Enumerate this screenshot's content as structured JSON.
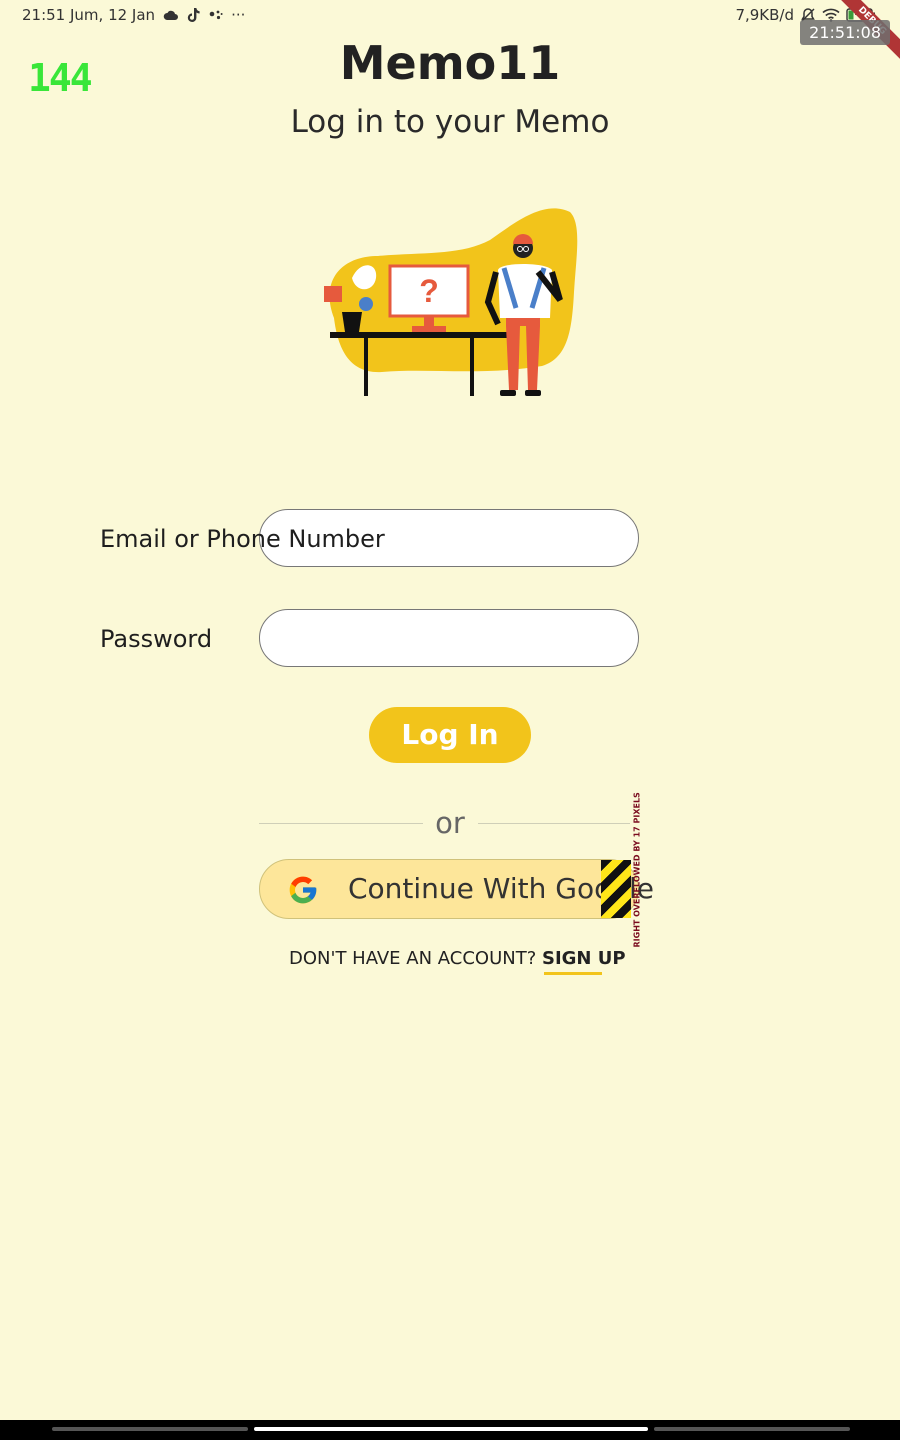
{
  "status_bar": {
    "time_date": "21:51 Jum, 12 Jan",
    "more": "···",
    "network_speed": "7,9KB/d",
    "battery_level": "14"
  },
  "overlays": {
    "fps_counter": "144",
    "clock": "21:51:08",
    "debug_banner": "DEBUG"
  },
  "header": {
    "title": "Memo11",
    "subtitle": "Log in to your Memo"
  },
  "illustration": {
    "monitor_symbol": "?"
  },
  "form": {
    "email_label": "Email or Phone Number",
    "email_value": "",
    "password_label": "Password",
    "password_value": "",
    "login_label": "Log In"
  },
  "divider": {
    "text": "or"
  },
  "google": {
    "label": "Continue With Google",
    "overflow_warning": "RIGHT OVERFLOWED BY 17 PIXELS"
  },
  "signup": {
    "prompt": "DON'T HAVE AN ACCOUNT?",
    "link": "SIGN UP"
  },
  "colors": {
    "background": "#fbf9d7",
    "accent": "#f2c41b",
    "google_button": "#fde69a",
    "fps": "#39e639"
  },
  "icons": [
    "cloud-icon",
    "tiktok-icon",
    "assistant-icon",
    "mute-icon",
    "wifi-icon",
    "battery-icon",
    "google-icon"
  ]
}
